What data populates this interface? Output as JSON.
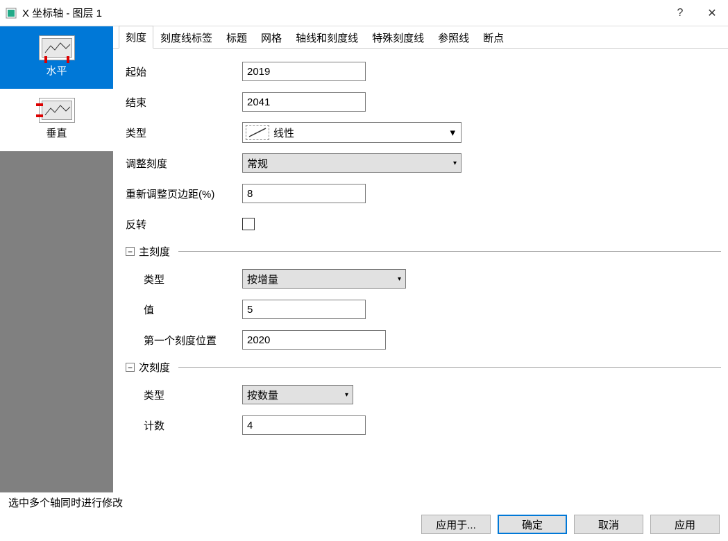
{
  "window": {
    "title": "X 坐标轴 - 图层 1",
    "help": "?",
    "close": "✕"
  },
  "sidebar": {
    "items": [
      {
        "label": "水平",
        "active": true
      },
      {
        "label": "垂直",
        "active": false
      }
    ]
  },
  "tabs": {
    "items": [
      {
        "label": "刻度",
        "active": true
      },
      {
        "label": "刻度线标签"
      },
      {
        "label": "标题"
      },
      {
        "label": "网格"
      },
      {
        "label": "轴线和刻度线"
      },
      {
        "label": "特殊刻度线"
      },
      {
        "label": "参照线"
      },
      {
        "label": "断点"
      }
    ]
  },
  "form": {
    "start_label": "起始",
    "start_value": "2019",
    "end_label": "结束",
    "end_value": "2041",
    "type_label": "类型",
    "type_value": "线性",
    "rescale_label": "调整刻度",
    "rescale_value": "常规",
    "margin_label": "重新调整页边距(%)",
    "margin_value": "8",
    "reverse_label": "反转",
    "major_section": "主刻度",
    "major_type_label": "类型",
    "major_type_value": "按增量",
    "major_value_label": "值",
    "major_value": "5",
    "first_tick_label": "第一个刻度位置",
    "first_tick_value": "2020",
    "minor_section": "次刻度",
    "minor_type_label": "类型",
    "minor_type_value": "按数量",
    "minor_count_label": "计数",
    "minor_count_value": "4"
  },
  "status": "选中多个轴同时进行修改",
  "buttons": {
    "apply_to": "应用于...",
    "ok": "确定",
    "cancel": "取消",
    "apply": "应用"
  }
}
